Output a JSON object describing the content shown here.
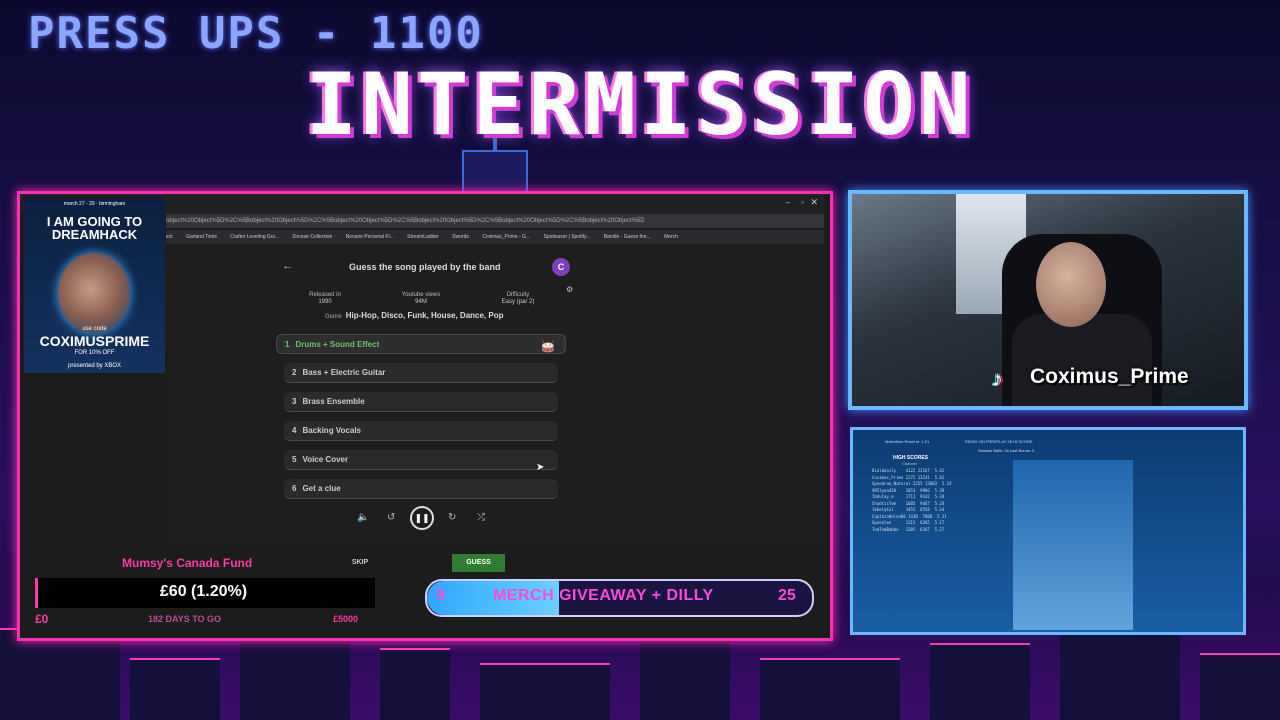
{
  "overlay": {
    "press_ups": "PRESS UPS - 1100",
    "intermission": "INTERMISSION"
  },
  "browser": {
    "tab_url": "object%20Object%5D%2C%5Bobject%20Object%5D%2C%5Bobject%20Object%5D%2C%5Bobject%20Object%5D%2C%5Bobject%20Object%5D%2C%5Bobject%20Object%5D",
    "bookmarks": [
      "ect",
      "Garland Tools",
      "Crafter Leveling Gui...",
      "Zonzae Collection",
      "Novune Personal Fl...",
      "StreamLadder",
      "Swords",
      "Coximus_Prime - G...",
      "Spotisaver | Spotify...",
      "Bandle - Guess the...",
      "Merch"
    ]
  },
  "promo": {
    "date": "march 27 - 29",
    "city": "birmingham",
    "headline": "I AM GOING TO DREAMHACK",
    "use_code": "use code",
    "code": "COXIMUSPRIME",
    "discount": "FOR 10% OFF",
    "presented": "presented by XBOX"
  },
  "game": {
    "title": "Guess the song played by the band",
    "avatar_letter": "C",
    "released_label": "Released in",
    "released_value": "1990",
    "views_label": "Youtube views",
    "views_value": "94M",
    "difficulty_label": "Difficulty",
    "difficulty_value": "Easy (par 2)",
    "genre_label": "Genre",
    "genre_value": "Hip-Hop, Disco, Funk, House, Dance, Pop",
    "rows": [
      {
        "num": "1",
        "label": "Drums + Sound Effect"
      },
      {
        "num": "2",
        "label": "Bass + Electric Guitar"
      },
      {
        "num": "3",
        "label": "Brass Ensemble"
      },
      {
        "num": "4",
        "label": "Backing Vocals"
      },
      {
        "num": "5",
        "label": "Voice Cover"
      },
      {
        "num": "6",
        "label": "Get a clue"
      }
    ],
    "skip": "SKIP",
    "guess": "GUESS",
    "colors": {
      "accent": "#6ec36e",
      "guess_bg": "#2e7d32"
    }
  },
  "fund": {
    "title": "Mumsy's Canada Fund",
    "amount": "£60 (1.20%)",
    "min": "£0",
    "days": "182 DAYS TO GO",
    "max": "£5000",
    "progress": 0.012
  },
  "giveaway": {
    "current": "9",
    "text": "MERCH GIVEAWAY + DILLY",
    "goal": "25"
  },
  "webcam": {
    "name": "Coximus_Prime"
  },
  "scoreboard": {
    "top_left": "Matchtime Reset in: 1:21",
    "top_mid": "REMIX ON   FREEPLAY 28   HI SCORE",
    "session": "Session Balls: 28   Last Bonus: 0",
    "title": "HIGH SCORES",
    "channel": "Channel",
    "entries": "Bialdanily    4122 22167  5.42\nCoximus_Prime 2275 13241  5.82\nSpeedrun_Natural 2255 13003  5.18\nSMIlyon428    1853  9986  5.39\nlbdulay_e     1711  9142  5.34\nChaoticTem    1605  9467  5.24\nlkbelqtal     1455  8558  5.34\nCaptainHelen68 1430  7808  5.21\nSpoonlee      1215  6265  5.17\nTomTomBabbe   1205  6167  5.27"
  }
}
